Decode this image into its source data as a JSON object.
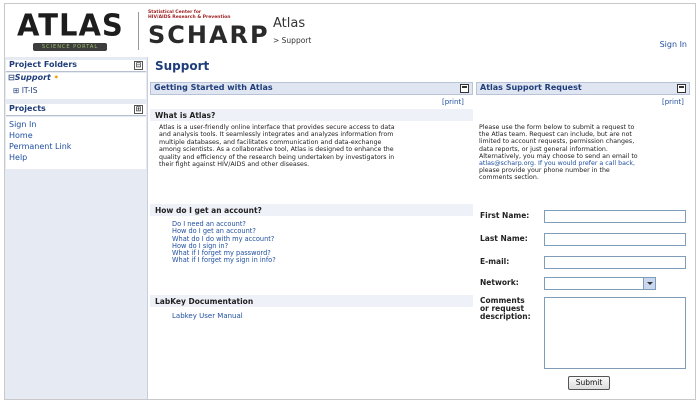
{
  "header": {
    "atlas_logo_text": "ATLAS",
    "atlas_logo_band": "SCIENCE PORTAL",
    "scharp_small_line1": "Statistical Center for",
    "scharp_small_line2": "HIV/AIDS Research & Prevention",
    "scharp_word": "SCHARP",
    "app_title": "Atlas",
    "breadcrumb": "> Support",
    "sign_in": "Sign In"
  },
  "sidebar": {
    "project_folders_title": "Project Folders",
    "project_folders_toggle": "⊟",
    "support_folder": "Support",
    "support_folder_toggle": "⊟",
    "itis_folder": "IT-IS",
    "itis_folder_toggle": "⊞",
    "projects_title": "Projects",
    "projects_toggle": "⊞",
    "links": [
      "Sign In",
      "Home",
      "Permanent Link",
      "Help"
    ]
  },
  "main": {
    "page_title": "Support",
    "getting_started": {
      "title": "Getting Started with Atlas",
      "print": "[print]",
      "what_is_heading": "What is Atlas?",
      "what_is_lines": [
        "Atlas is a user-friendly online interface that provides secure access to data",
        "and analysis tools. It seamlessly integrates and analyzes information from",
        "multiple databases, and facilitates communication and data-exchange",
        "among scientists. As a collaborative tool, Atlas is designed to enhance the",
        "quality and efficiency of the research being undertaken by investigators in",
        "their fight against HIV/AIDS and other diseases."
      ],
      "account_heading": "How do I get an account?",
      "account_links": [
        "Do I need an account?",
        "How do I get an account?",
        "What do I do with my account?",
        "How do I sign in?",
        "What if I forget my password?",
        "What if I forget my sign in info?"
      ],
      "labkey_heading": "LabKey Documentation",
      "labkey_link": "Labkey User Manual"
    },
    "support_request": {
      "title": "Atlas Support Request",
      "print": "[print]",
      "intro_lines": [
        "Please use the form below to submit a request to",
        "the Atlas team. Request can include, but are not",
        "limited to account requests, permission changes,",
        "data reports, or just general information.",
        "Alternatively, you may choose to send an email to",
        "atlas@scharp.org. If you would prefer a call back,",
        "please provide your phone number in the",
        "comments section."
      ],
      "first_name_label": "First Name:",
      "last_name_label": "Last Name:",
      "email_label": "E-mail:",
      "network_label": "Network:",
      "comments_label_lines": [
        "Comments",
        "or request",
        "description:"
      ],
      "first_name_value": "",
      "last_name_value": "",
      "email_value": "",
      "network_value": "",
      "comments_value": "",
      "submit_label": "Submit"
    }
  }
}
